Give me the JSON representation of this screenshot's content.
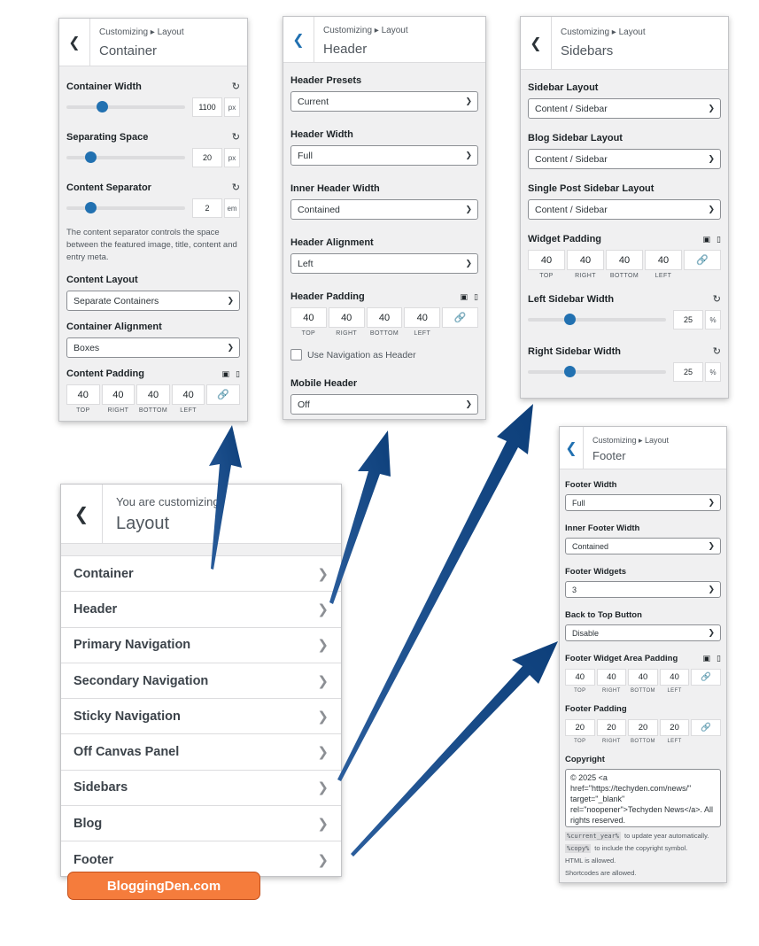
{
  "container_panel": {
    "breadcrumb": "Customizing ▸ Layout",
    "title": "Container",
    "container_width": {
      "label": "Container Width",
      "value": "1100",
      "unit": "px",
      "fraction": 0.3
    },
    "separating_space": {
      "label": "Separating Space",
      "value": "20",
      "unit": "px",
      "fraction": 0.2
    },
    "content_separator": {
      "label": "Content Separator",
      "value": "2",
      "unit": "em",
      "fraction": 0.2
    },
    "separator_desc": "The content separator controls the space between the featured image, title, content and entry meta.",
    "content_layout": {
      "label": "Content Layout",
      "value": "Separate Containers"
    },
    "container_alignment": {
      "label": "Container Alignment",
      "value": "Boxes"
    },
    "content_padding": {
      "label": "Content Padding",
      "values": [
        "40",
        "40",
        "40",
        "40"
      ],
      "labels": [
        "TOP",
        "RIGHT",
        "BOTTOM",
        "LEFT"
      ]
    }
  },
  "header_panel": {
    "breadcrumb": "Customizing ▸ Layout",
    "title": "Header",
    "header_presets": {
      "label": "Header Presets",
      "value": "Current"
    },
    "header_width": {
      "label": "Header Width",
      "value": "Full"
    },
    "inner_header_width": {
      "label": "Inner Header Width",
      "value": "Contained"
    },
    "header_alignment": {
      "label": "Header Alignment",
      "value": "Left"
    },
    "header_padding": {
      "label": "Header Padding",
      "values": [
        "40",
        "40",
        "40",
        "40"
      ],
      "labels": [
        "TOP",
        "RIGHT",
        "BOTTOM",
        "LEFT"
      ]
    },
    "use_nav_label": "Use Navigation as Header",
    "mobile_header": {
      "label": "Mobile Header",
      "value": "Off"
    }
  },
  "sidebars_panel": {
    "breadcrumb": "Customizing ▸ Layout",
    "title": "Sidebars",
    "sidebar_layout": {
      "label": "Sidebar Layout",
      "value": "Content / Sidebar"
    },
    "blog_sidebar_layout": {
      "label": "Blog Sidebar Layout",
      "value": "Content / Sidebar"
    },
    "single_post_sidebar_layout": {
      "label": "Single Post Sidebar Layout",
      "value": "Content / Sidebar"
    },
    "widget_padding": {
      "label": "Widget Padding",
      "values": [
        "40",
        "40",
        "40",
        "40"
      ],
      "labels": [
        "TOP",
        "RIGHT",
        "BOTTOM",
        "LEFT"
      ]
    },
    "left_sidebar_width": {
      "label": "Left Sidebar Width",
      "value": "25",
      "unit": "%",
      "fraction": 0.3
    },
    "right_sidebar_width": {
      "label": "Right Sidebar Width",
      "value": "25",
      "unit": "%",
      "fraction": 0.3
    }
  },
  "footer_panel": {
    "breadcrumb": "Customizing ▸ Layout",
    "title": "Footer",
    "footer_width": {
      "label": "Footer Width",
      "value": "Full"
    },
    "inner_footer_width": {
      "label": "Inner Footer Width",
      "value": "Contained"
    },
    "footer_widgets": {
      "label": "Footer Widgets",
      "value": "3"
    },
    "back_to_top": {
      "label": "Back to Top Button",
      "value": "Disable"
    },
    "widget_area_padding": {
      "label": "Footer Widget Area Padding",
      "values": [
        "40",
        "40",
        "40",
        "40"
      ],
      "labels": [
        "TOP",
        "RIGHT",
        "BOTTOM",
        "LEFT"
      ]
    },
    "footer_padding": {
      "label": "Footer Padding",
      "values": [
        "20",
        "20",
        "20",
        "20"
      ],
      "labels": [
        "TOP",
        "RIGHT",
        "BOTTOM",
        "LEFT"
      ]
    },
    "copyright": {
      "label": "Copyright",
      "value": "© 2025 <a href=\"https://techyden.com/news/\" target=\"_blank\" rel=\"noopener\">Techyden News</a>. All rights reserved."
    },
    "note_year_code": "%current_year%",
    "note_year_text": "to update year automatically.",
    "note_copy_code": "%copy%",
    "note_copy_text": "to include the copyright symbol.",
    "note_html": "HTML is allowed.",
    "note_shortcodes": "Shortcodes are allowed."
  },
  "layout_menu": {
    "subtitle": "You are customizing",
    "title": "Layout",
    "items": [
      "Container",
      "Header",
      "Primary Navigation",
      "Secondary Navigation",
      "Sticky Navigation",
      "Off Canvas Panel",
      "Sidebars",
      "Blog",
      "Footer"
    ]
  },
  "watermark": "BloggingDen.com",
  "colors": {
    "accent": "#2271b1",
    "arrow": "#0d3f7a",
    "badge": "#f57c3c"
  }
}
